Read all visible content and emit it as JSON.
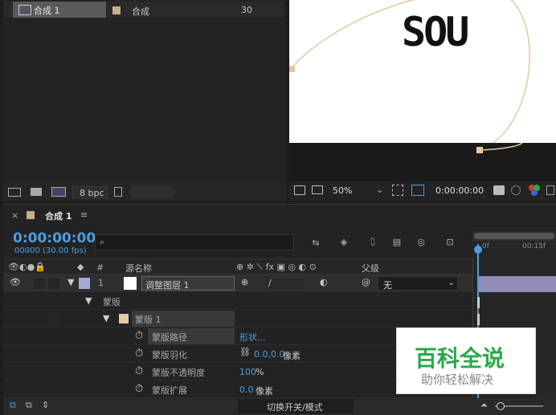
{
  "project": {
    "item_name": "合成 1",
    "item_type": "合成",
    "item_fps": "30",
    "bpc": "8 bpc",
    "label_color": "#c7b089"
  },
  "viewer": {
    "logo_text": "SOU",
    "zoom": "50%",
    "timecode": "0:00:00:00"
  },
  "timeline": {
    "tab_title": "合成 1",
    "current_time": "0:00:00:00",
    "frame_info": "00000 (30.00 fps)",
    "search_placeholder": "",
    "columns": {
      "hash": "#",
      "source_name": "源名称",
      "parent": "父级"
    },
    "layer": {
      "number": "1",
      "name": "调整图层 1",
      "parent": "无"
    },
    "mask_group": "蒙版",
    "mask_name": "蒙版 1",
    "properties": [
      {
        "name": "蒙版路径",
        "value": "形状..."
      },
      {
        "name": "蒙版羽化",
        "value": "0.0,0.0",
        "unit": "像素"
      },
      {
        "name": "蒙版不透明度",
        "value": "100",
        "unit": "%"
      },
      {
        "name": "蒙版扩展",
        "value": "0.0",
        "unit": "像素"
      }
    ],
    "ruler": {
      "start": "0f",
      "mark": "00:15f"
    },
    "toggle_modes": "切换开关/模式"
  },
  "watermark": {
    "title": "百科全说",
    "subtitle": "助你轻松解决"
  }
}
